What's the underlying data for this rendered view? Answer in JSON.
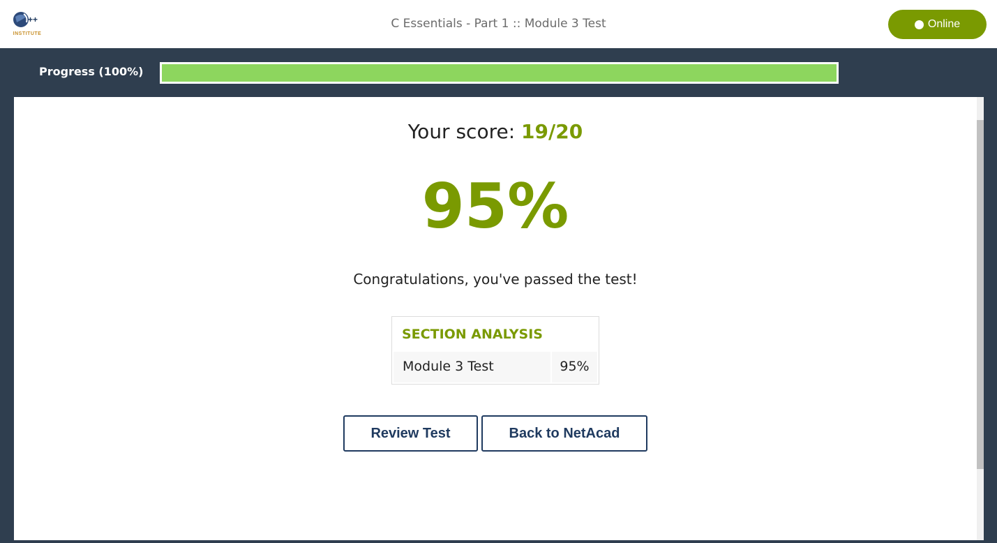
{
  "header": {
    "logo_text": "INSTITUTE",
    "logo_mark": "C++",
    "title": "C Essentials - Part 1 :: Module 3 Test",
    "status_label": "Online",
    "status_color": "#7a9a01"
  },
  "progress": {
    "label": "Progress (100%)",
    "percent": 100,
    "fill_color": "#8dd65e"
  },
  "result": {
    "score_prefix": "Your score:",
    "score_value": "19/20",
    "percent": "95%",
    "message": "Congratulations, you've passed the test!",
    "accent_color": "#7a9a01"
  },
  "section_analysis": {
    "title": "SECTION ANALYSIS",
    "rows": [
      {
        "name": "Module 3 Test",
        "value": "95%"
      }
    ]
  },
  "actions": {
    "review_label": "Review Test",
    "back_label": "Back to NetAcad"
  }
}
